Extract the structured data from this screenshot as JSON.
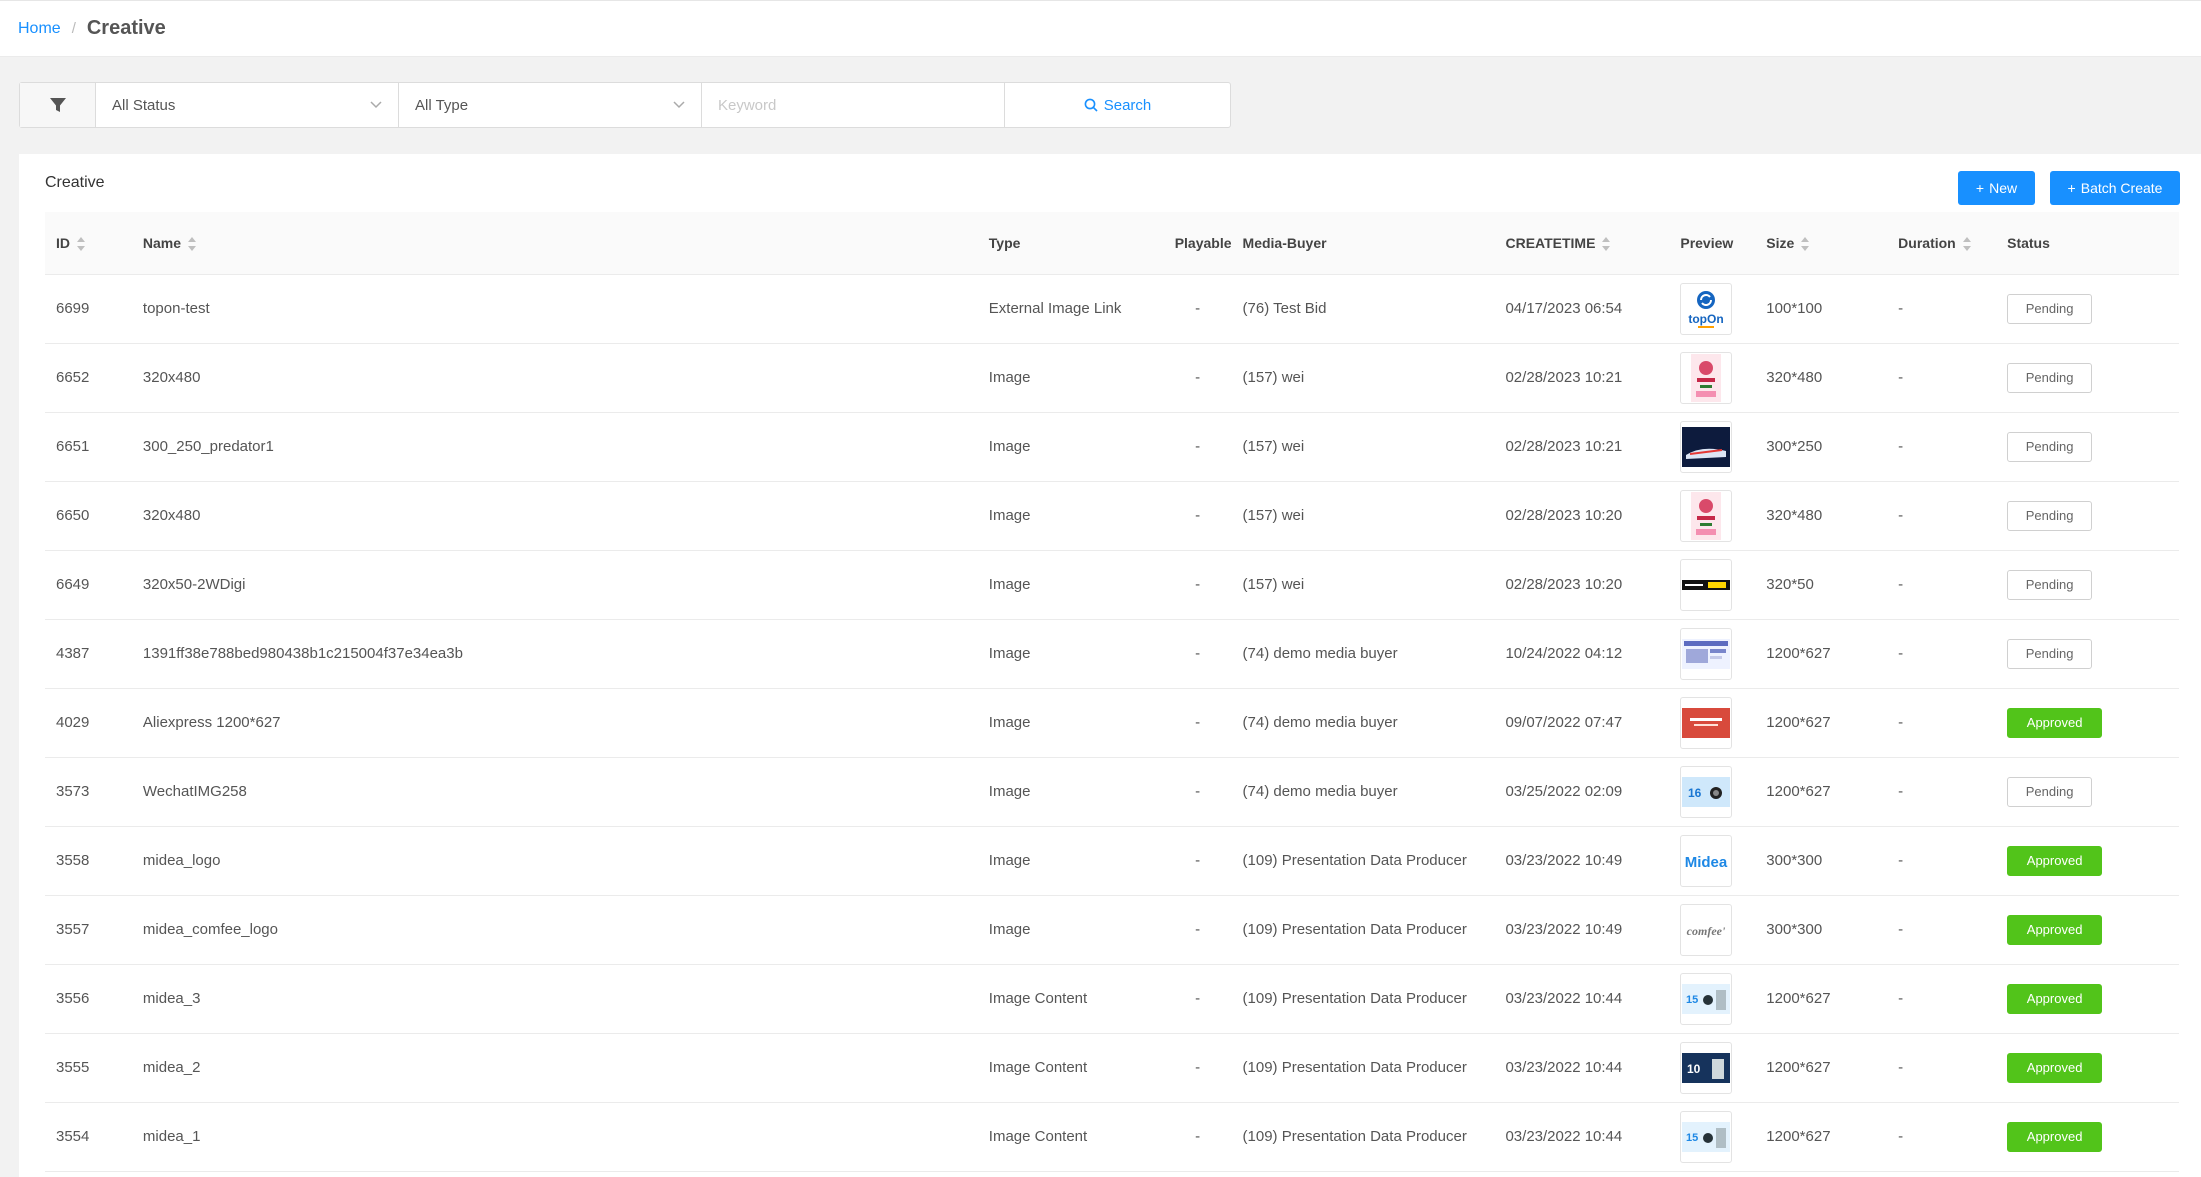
{
  "breadcrumb": {
    "home": "Home",
    "separator": "/",
    "current": "Creative"
  },
  "filters": {
    "status": "All Status",
    "type": "All Type",
    "keyword_placeholder": "Keyword",
    "search": "Search"
  },
  "panel": {
    "title": "Creative",
    "new_label": "New",
    "batch_label": "Batch Create"
  },
  "table": {
    "columns": {
      "id": "ID",
      "name": "Name",
      "type": "Type",
      "playable": "Playable",
      "media_buyer": "Media-Buyer",
      "createtime": "CREATETIME",
      "preview": "Preview",
      "size": "Size",
      "duration": "Duration",
      "status": "Status"
    },
    "rows": [
      {
        "id": "6699",
        "name": "topon-test",
        "type": "External Image Link",
        "playable": "-",
        "media_buyer": "(76) Test Bid",
        "createtime": "04/17/2023 06:54",
        "preview": "topon-logo",
        "size": "100*100",
        "duration": "-",
        "status": "Pending"
      },
      {
        "id": "6652",
        "name": "320x480",
        "type": "Image",
        "playable": "-",
        "media_buyer": "(157) wei",
        "createtime": "02/28/2023 10:21",
        "preview": "valentine-ad",
        "size": "320*480",
        "duration": "-",
        "status": "Pending"
      },
      {
        "id": "6651",
        "name": "300_250_predator1",
        "type": "Image",
        "playable": "-",
        "media_buyer": "(157) wei",
        "createtime": "02/28/2023 10:21",
        "preview": "shoe-ad",
        "size": "300*250",
        "duration": "-",
        "status": "Pending"
      },
      {
        "id": "6650",
        "name": "320x480",
        "type": "Image",
        "playable": "-",
        "media_buyer": "(157) wei",
        "createtime": "02/28/2023 10:20",
        "preview": "valentine-ad",
        "size": "320*480",
        "duration": "-",
        "status": "Pending"
      },
      {
        "id": "6649",
        "name": "320x50-2WDigi",
        "type": "Image",
        "playable": "-",
        "media_buyer": "(157) wei",
        "createtime": "02/28/2023 10:20",
        "preview": "banner-ad",
        "size": "320*50",
        "duration": "-",
        "status": "Pending"
      },
      {
        "id": "4387",
        "name": "1391ff38e788bed980438b1c215004f37e34ea3b",
        "type": "Image",
        "playable": "-",
        "media_buyer": "(74) demo media buyer",
        "createtime": "10/24/2022 04:12",
        "preview": "web-ad",
        "size": "1200*627",
        "duration": "-",
        "status": "Pending"
      },
      {
        "id": "4029",
        "name": "Aliexpress 1200*627",
        "type": "Image",
        "playable": "-",
        "media_buyer": "(74) demo media buyer",
        "createtime": "09/07/2022 07:47",
        "preview": "aliexpress-ad",
        "size": "1200*627",
        "duration": "-",
        "status": "Approved"
      },
      {
        "id": "3573",
        "name": "WechatIMG258",
        "type": "Image",
        "playable": "-",
        "media_buyer": "(74) demo media buyer",
        "createtime": "03/25/2022 02:09",
        "preview": "promo-ad",
        "size": "1200*627",
        "duration": "-",
        "status": "Pending"
      },
      {
        "id": "3558",
        "name": "midea_logo",
        "type": "Image",
        "playable": "-",
        "media_buyer": "(109) Presentation Data Producer",
        "createtime": "03/23/2022 10:49",
        "preview": "midea-logo",
        "size": "300*300",
        "duration": "-",
        "status": "Approved"
      },
      {
        "id": "3557",
        "name": "midea_comfee_logo",
        "type": "Image",
        "playable": "-",
        "media_buyer": "(109) Presentation Data Producer",
        "createtime": "03/23/2022 10:49",
        "preview": "comfee-logo",
        "size": "300*300",
        "duration": "-",
        "status": "Approved"
      },
      {
        "id": "3556",
        "name": "midea_3",
        "type": "Image Content",
        "playable": "-",
        "media_buyer": "(109) Presentation Data Producer",
        "createtime": "03/23/2022 10:44",
        "preview": "appliance-ad",
        "size": "1200*627",
        "duration": "-",
        "status": "Approved"
      },
      {
        "id": "3555",
        "name": "midea_2",
        "type": "Image Content",
        "playable": "-",
        "media_buyer": "(109) Presentation Data Producer",
        "createtime": "03/23/2022 10:44",
        "preview": "appliance-ad-dark",
        "size": "1200*627",
        "duration": "-",
        "status": "Approved"
      },
      {
        "id": "3554",
        "name": "midea_1",
        "type": "Image Content",
        "playable": "-",
        "media_buyer": "(109) Presentation Data Producer",
        "createtime": "03/23/2022 10:44",
        "preview": "appliance-ad",
        "size": "1200*627",
        "duration": "-",
        "status": "Approved"
      }
    ]
  },
  "colors": {
    "primary": "#1890ff",
    "approved": "#52c41a",
    "background": "#f2f2f2"
  },
  "preview_logo_text": {
    "topon": "topOn",
    "midea": "Midea",
    "comfee": "comfee'"
  }
}
